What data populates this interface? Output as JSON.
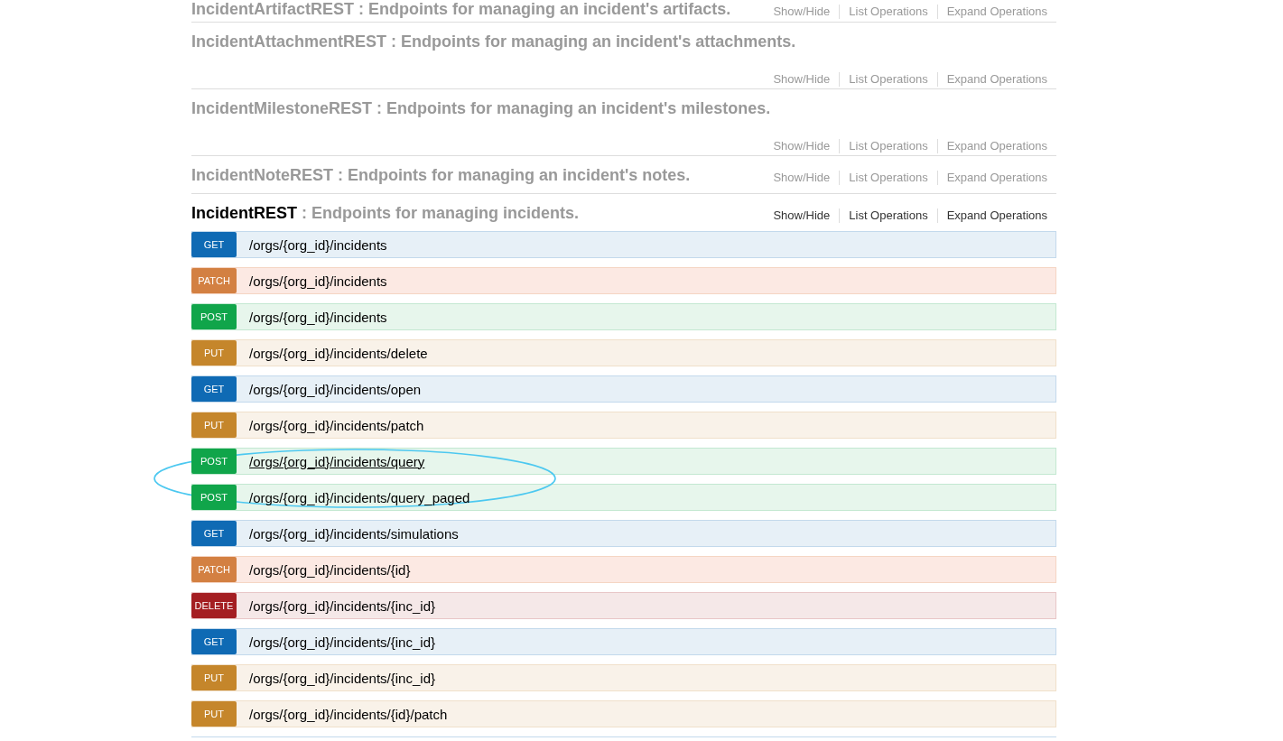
{
  "sections": [
    {
      "name": "IncidentArtifactREST",
      "description": ": Endpoints for managing an incident's artifacts.",
      "active": false,
      "links": [
        "Show/Hide",
        "List Operations",
        "Expand Operations"
      ]
    },
    {
      "name": "IncidentAttachmentREST",
      "description": ": Endpoints for managing an incident's attachments.",
      "active": false,
      "links": [
        "Show/Hide",
        "List Operations",
        "Expand Operations"
      ]
    },
    {
      "name": "IncidentMilestoneREST",
      "description": ": Endpoints for managing an incident's milestones.",
      "active": false,
      "links": [
        "Show/Hide",
        "List Operations",
        "Expand Operations"
      ]
    },
    {
      "name": "IncidentNoteREST",
      "description": ": Endpoints for managing an incident's notes.",
      "active": false,
      "links": [
        "Show/Hide",
        "List Operations",
        "Expand Operations"
      ]
    },
    {
      "name": "IncidentREST",
      "description": ": Endpoints for managing incidents.",
      "active": true,
      "links": [
        "Show/Hide",
        "List Operations",
        "Expand Operations"
      ],
      "operations": [
        {
          "kind": "get",
          "method": "GET",
          "path": "/orgs/{org_id}/incidents",
          "hovered": false
        },
        {
          "kind": "patch",
          "method": "PATCH",
          "path": "/orgs/{org_id}/incidents",
          "hovered": false
        },
        {
          "kind": "post",
          "method": "POST",
          "path": "/orgs/{org_id}/incidents",
          "hovered": false
        },
        {
          "kind": "put",
          "method": "PUT",
          "path": "/orgs/{org_id}/incidents/delete",
          "hovered": false
        },
        {
          "kind": "get",
          "method": "GET",
          "path": "/orgs/{org_id}/incidents/open",
          "hovered": false
        },
        {
          "kind": "put",
          "method": "PUT",
          "path": "/orgs/{org_id}/incidents/patch",
          "hovered": false
        },
        {
          "kind": "post",
          "method": "POST",
          "path": "/orgs/{org_id}/incidents/query",
          "hovered": true
        },
        {
          "kind": "post",
          "method": "POST",
          "path": "/orgs/{org_id}/incidents/query_paged",
          "hovered": false
        },
        {
          "kind": "get",
          "method": "GET",
          "path": "/orgs/{org_id}/incidents/simulations",
          "hovered": false
        },
        {
          "kind": "patch",
          "method": "PATCH",
          "path": "/orgs/{org_id}/incidents/{id}",
          "hovered": false
        },
        {
          "kind": "delete",
          "method": "DELETE",
          "path": "/orgs/{org_id}/incidents/{inc_id}",
          "hovered": false
        },
        {
          "kind": "get",
          "method": "GET",
          "path": "/orgs/{org_id}/incidents/{inc_id}",
          "hovered": false
        },
        {
          "kind": "put",
          "method": "PUT",
          "path": "/orgs/{org_id}/incidents/{inc_id}",
          "hovered": false
        },
        {
          "kind": "put",
          "method": "PUT",
          "path": "/orgs/{org_id}/incidents/{id}/patch",
          "hovered": false
        }
      ]
    }
  ],
  "annotation": {
    "kind": "ellipse"
  }
}
